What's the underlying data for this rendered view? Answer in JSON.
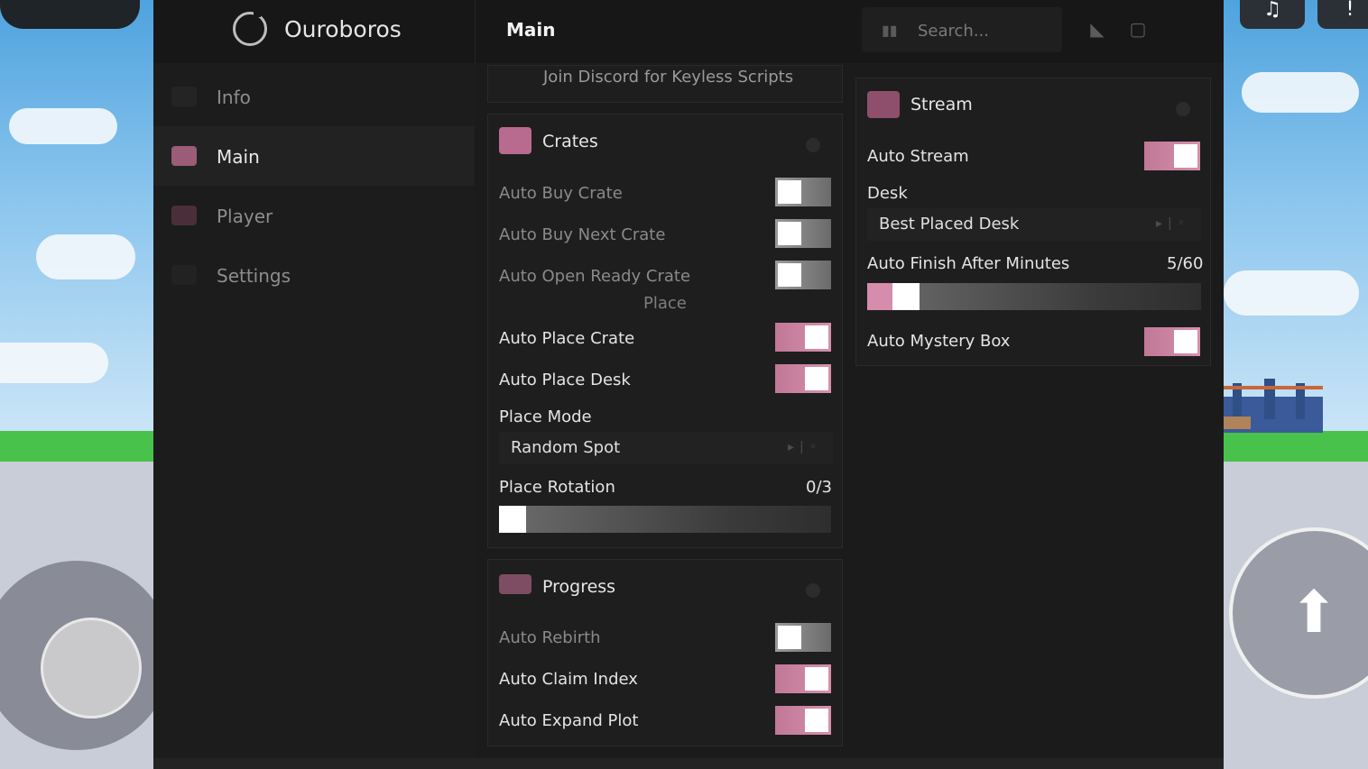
{
  "window": {
    "app_name": "Ouroboros",
    "page_title": "Main"
  },
  "search": {
    "placeholder": "Search..."
  },
  "sidebar": {
    "items": [
      {
        "label": "Info",
        "icon": "moon-icon",
        "active": false
      },
      {
        "label": "Main",
        "icon": "home-icon",
        "active": true
      },
      {
        "label": "Player",
        "icon": "user-icon",
        "active": false
      },
      {
        "label": "Settings",
        "icon": "gear-icon",
        "active": false
      }
    ]
  },
  "discord_banner": {
    "text": "Join Discord for Keyless Scripts"
  },
  "crates": {
    "title": "Crates",
    "icon": "crate-icon",
    "auto_buy_crate": {
      "label": "Auto Buy Crate",
      "on": false
    },
    "auto_buy_next_crate": {
      "label": "Auto Buy Next Crate",
      "on": false
    },
    "auto_open_ready_crate": {
      "label": "Auto Open Ready Crate",
      "on": false
    },
    "place_caption": "Place",
    "auto_place_crate": {
      "label": "Auto Place Crate",
      "on": true
    },
    "auto_place_desk": {
      "label": "Auto Place Desk",
      "on": true
    },
    "place_mode": {
      "label": "Place Mode",
      "value": "Random Spot"
    },
    "place_rotation": {
      "label": "Place Rotation",
      "value_text": "0/3",
      "value": 0,
      "max": 3
    }
  },
  "progress": {
    "title": "Progress",
    "icon": "progress-icon",
    "auto_rebirth": {
      "label": "Auto Rebirth",
      "on": false
    },
    "auto_claim_index": {
      "label": "Auto Claim Index",
      "on": true
    },
    "auto_expand_plot": {
      "label": "Auto Expand Plot",
      "on": true
    }
  },
  "stream": {
    "title": "Stream",
    "icon": "stream-icon",
    "auto_stream": {
      "label": "Auto Stream",
      "on": true
    },
    "desk": {
      "label": "Desk",
      "value": "Best Placed Desk"
    },
    "auto_finish": {
      "label": "Auto Finish After Minutes",
      "value_text": "5/60",
      "value": 5,
      "max": 60
    },
    "auto_mystery_box": {
      "label": "Auto Mystery Box",
      "on": true
    }
  },
  "colors": {
    "accent": "#d68cad",
    "panel_bg": "#1b1b1b",
    "section_bg": "#1e1e1e",
    "text": "#e4e4e4",
    "text_muted": "#8a8a8a"
  }
}
